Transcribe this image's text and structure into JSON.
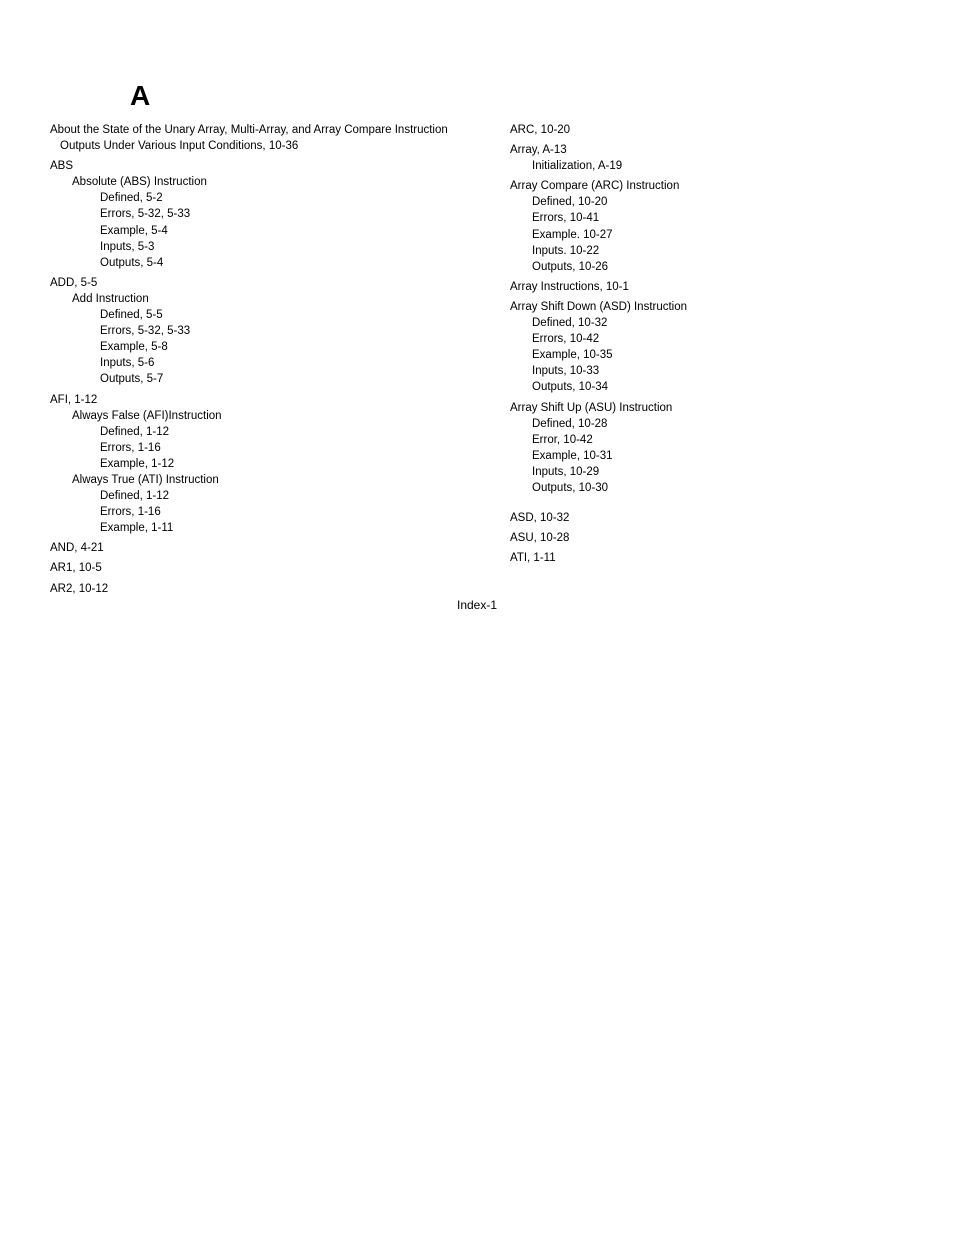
{
  "section_letter": "A",
  "left": {
    "about": "About the State of the Unary Array, Multi-Array, and Array Compare Instruction Outputs Under Various Input Conditions, 10-36",
    "abs": {
      "head": "ABS",
      "sub1": "Absolute (ABS) Instruction",
      "defined": "Defined, 5-2",
      "errors": "Errors, 5-32, 5-33",
      "example": "Example, 5-4",
      "inputs": "Inputs, 5-3",
      "outputs": "Outputs, 5-4"
    },
    "add": {
      "head": "ADD, 5-5",
      "sub1": "Add Instruction",
      "defined": "Defined, 5-5",
      "errors": "Errors, 5-32, 5-33",
      "example": "Example, 5-8",
      "inputs": "Inputs, 5-6",
      "outputs": "Outputs, 5-7"
    },
    "afi": {
      "head": "AFI, 1-12",
      "sub1": "Always False (AFI)Instruction",
      "defined1": "Defined, 1-12",
      "errors1": "Errors, 1-16",
      "example1": "Example, 1-12",
      "sub2": "Always True (ATI) Instruction",
      "defined2": "Defined, 1-12",
      "errors2": "Errors, 1-16",
      "example2": "Example, 1-11"
    },
    "and": "AND, 4-21",
    "ar1": "AR1, 10-5",
    "ar2": "AR2, 10-12"
  },
  "right": {
    "arc": "ARC, 10-20",
    "array": {
      "head": "Array, A-13",
      "init": "Initialization, A-19"
    },
    "arc_instr": {
      "head": "Array Compare (ARC) Instruction",
      "defined": "Defined, 10-20",
      "errors": "Errors, 10-41",
      "example": "Example. 10-27",
      "inputs": "Inputs. 10-22",
      "outputs": "Outputs, 10-26"
    },
    "array_instr": "Array Instructions, 10-1",
    "asd": {
      "head": "Array Shift Down (ASD) Instruction",
      "defined": "Defined, 10-32",
      "errors": "Errors, 10-42",
      "example": "Example, 10-35",
      "inputs": "Inputs, 10-33",
      "outputs": "Outputs, 10-34"
    },
    "asu": {
      "head": "Array Shift Up (ASU) Instruction",
      "defined": "Defined, 10-28",
      "error": "Error, 10-42",
      "example": "Example, 10-31",
      "inputs": "Inputs, 10-29",
      "outputs": "Outputs, 10-30"
    },
    "asd_short": "ASD, 10-32",
    "asu_short": "ASU, 10-28",
    "ati": "ATI, 1-11"
  },
  "footer": "Index-1"
}
